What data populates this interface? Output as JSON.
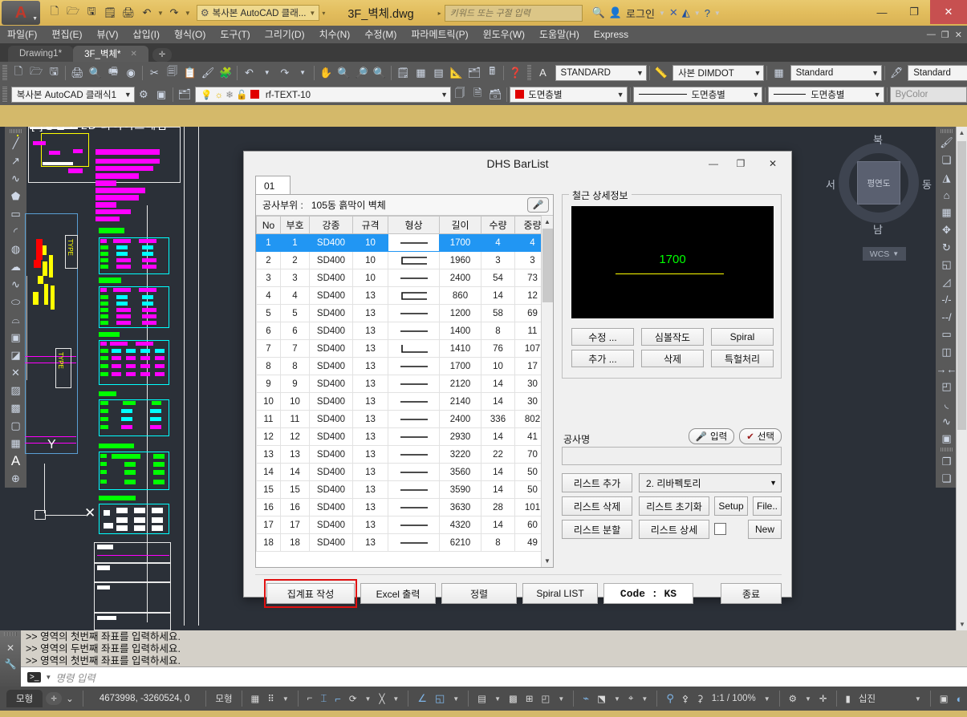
{
  "app": {
    "document_title": "3F_벽체.dwg",
    "workspace": "복사본 AutoCAD 클래...",
    "search_placeholder": "키워드 또는 구절 입력",
    "login_label": "로그인"
  },
  "menu": {
    "items": [
      "파일(F)",
      "편집(E)",
      "뷰(V)",
      "삽입(I)",
      "형식(O)",
      "도구(T)",
      "그리기(D)",
      "치수(N)",
      "수정(M)",
      "파라메트릭(P)",
      "윈도우(W)",
      "도움말(H)",
      "Express"
    ]
  },
  "doc_tabs": [
    {
      "label": "Drawing1*",
      "active": false
    },
    {
      "label": "3F_벽체*",
      "active": true
    }
  ],
  "toolbars": {
    "workspace_combo": "복사본 AutoCAD 클래식1",
    "layer_combo": "rf-TEXT-10",
    "text_style": "STANDARD",
    "dim_style": "사본 DIMDOT",
    "table_style": "Standard",
    "mleader_style": "Standard",
    "color_combo": "도면층별",
    "linetype_combo": "도면층별",
    "lineweight_combo": "도면층별",
    "plotstyle_combo": "ByColor",
    "color_hex": "#e00000"
  },
  "navcube": {
    "north": "북",
    "south": "남",
    "east": "동",
    "west": "서",
    "face": "평연도",
    "ucs": "WCS"
  },
  "command_line": {
    "history": [
      ">> 영역의  첫번째  좌표를  입력하세요.",
      ">> 영역의  두번째  좌표를  입력하세요.",
      ">> 영역의  첫번째  좌표를  입력하세요."
    ],
    "placeholder": "명령 입력"
  },
  "statusbar": {
    "model_tab": "모형",
    "coordinates": "4673998, -3260524, 0",
    "model_label": "모형",
    "scale": "1:1 / 100%",
    "units": "십진"
  },
  "dialog": {
    "title": "DHS BarList",
    "tab": "01",
    "worksite_label": "공사부위 :",
    "worksite_value": "105동 흙막이 벽체",
    "columns": [
      "No",
      "부호",
      "강종",
      "규격",
      "형상",
      "길이",
      "수량",
      "중량"
    ],
    "rows": [
      {
        "no": "1",
        "bu": "1",
        "steel": "SD400",
        "size": "10",
        "shape": "straight",
        "len": "1700",
        "qty": "4",
        "wt": "4",
        "selected": true
      },
      {
        "no": "2",
        "bu": "2",
        "steel": "SD400",
        "size": "10",
        "shape": "ubend",
        "len": "1960",
        "qty": "3",
        "wt": "3",
        "selected": false
      },
      {
        "no": "3",
        "bu": "3",
        "steel": "SD400",
        "size": "10",
        "shape": "straight",
        "len": "2400",
        "qty": "54",
        "wt": "73",
        "selected": false
      },
      {
        "no": "4",
        "bu": "4",
        "steel": "SD400",
        "size": "13",
        "shape": "ubend",
        "len": "860",
        "qty": "14",
        "wt": "12",
        "selected": false
      },
      {
        "no": "5",
        "bu": "5",
        "steel": "SD400",
        "size": "13",
        "shape": "straight",
        "len": "1200",
        "qty": "58",
        "wt": "69",
        "selected": false
      },
      {
        "no": "6",
        "bu": "6",
        "steel": "SD400",
        "size": "13",
        "shape": "straight",
        "len": "1400",
        "qty": "8",
        "wt": "11",
        "selected": false
      },
      {
        "no": "7",
        "bu": "7",
        "steel": "SD400",
        "size": "13",
        "shape": "lbend",
        "len": "1410",
        "qty": "76",
        "wt": "107",
        "selected": false
      },
      {
        "no": "8",
        "bu": "8",
        "steel": "SD400",
        "size": "13",
        "shape": "straight",
        "len": "1700",
        "qty": "10",
        "wt": "17",
        "selected": false
      },
      {
        "no": "9",
        "bu": "9",
        "steel": "SD400",
        "size": "13",
        "shape": "straight",
        "len": "2120",
        "qty": "14",
        "wt": "30",
        "selected": false
      },
      {
        "no": "10",
        "bu": "10",
        "steel": "SD400",
        "size": "13",
        "shape": "straight",
        "len": "2140",
        "qty": "14",
        "wt": "30",
        "selected": false
      },
      {
        "no": "11",
        "bu": "11",
        "steel": "SD400",
        "size": "13",
        "shape": "straight",
        "len": "2400",
        "qty": "336",
        "wt": "802",
        "selected": false
      },
      {
        "no": "12",
        "bu": "12",
        "steel": "SD400",
        "size": "13",
        "shape": "straight",
        "len": "2930",
        "qty": "14",
        "wt": "41",
        "selected": false
      },
      {
        "no": "13",
        "bu": "13",
        "steel": "SD400",
        "size": "13",
        "shape": "straight",
        "len": "3220",
        "qty": "22",
        "wt": "70",
        "selected": false
      },
      {
        "no": "14",
        "bu": "14",
        "steel": "SD400",
        "size": "13",
        "shape": "straight",
        "len": "3560",
        "qty": "14",
        "wt": "50",
        "selected": false
      },
      {
        "no": "15",
        "bu": "15",
        "steel": "SD400",
        "size": "13",
        "shape": "straight",
        "len": "3590",
        "qty": "14",
        "wt": "50",
        "selected": false
      },
      {
        "no": "16",
        "bu": "16",
        "steel": "SD400",
        "size": "13",
        "shape": "straight",
        "len": "3630",
        "qty": "28",
        "wt": "101",
        "selected": false
      },
      {
        "no": "17",
        "bu": "17",
        "steel": "SD400",
        "size": "13",
        "shape": "straight",
        "len": "4320",
        "qty": "14",
        "wt": "60",
        "selected": false
      },
      {
        "no": "18",
        "bu": "18",
        "steel": "SD400",
        "size": "13",
        "shape": "straight",
        "len": "6210",
        "qty": "8",
        "wt": "49",
        "selected": false
      }
    ],
    "detail": {
      "group_title": "철근 상세정보",
      "preview_length": "1700",
      "buttons": [
        "수정 ...",
        "심볼작도",
        "Spiral",
        "추가 ...",
        "삭제",
        "특헐처리"
      ]
    },
    "jobname": {
      "label": "공사명",
      "value": "",
      "input_btn": "입력",
      "select_btn": "선택"
    },
    "list_controls": {
      "add": "리스트 추가",
      "delete": "리스트 삭제",
      "split": "리스트 분할",
      "reset": "리스트 초기화",
      "detail": "리스트 상세",
      "setup": "Setup",
      "file": "File..",
      "new": "New",
      "dropdown_value": "2. 리바펙토리"
    },
    "bottom": {
      "make_table": "집계표 작성",
      "excel": "Excel 출력",
      "sort": "정렬",
      "spiral_list": "Spiral LIST",
      "code": "Code : KS",
      "exit": "종료"
    }
  }
}
